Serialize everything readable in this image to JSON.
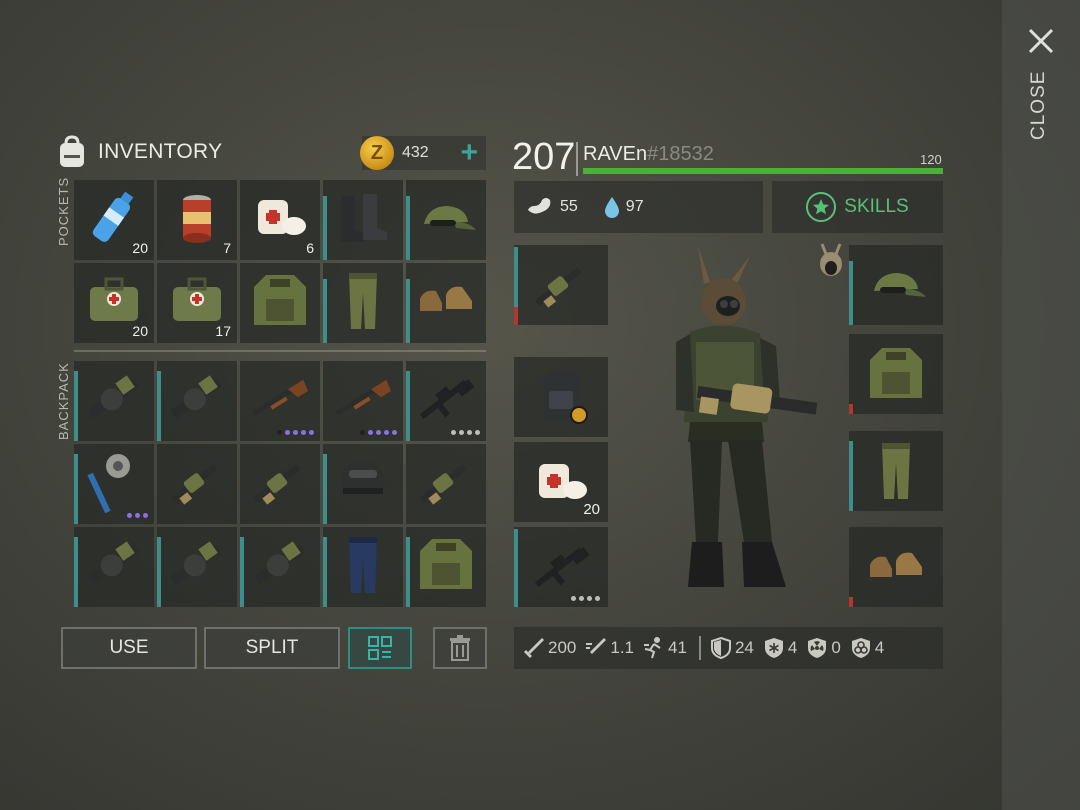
{
  "header": {
    "title": "INVENTORY",
    "coins": "432",
    "add_label": "+"
  },
  "close_label": "CLOSE",
  "sections": {
    "pockets": "POCKETS",
    "backpack": "BACKPACK"
  },
  "pockets": [
    {
      "name": "water-bottle",
      "qty": "20"
    },
    {
      "name": "canned-food",
      "qty": "7"
    },
    {
      "name": "bandage",
      "qty": "6"
    },
    {
      "name": "boots",
      "qty": ""
    },
    {
      "name": "camo-cap",
      "qty": ""
    },
    {
      "name": "medkit-bag",
      "qty": "20"
    },
    {
      "name": "medkit-bag",
      "qty": "17"
    },
    {
      "name": "camo-vest",
      "qty": ""
    },
    {
      "name": "camo-pants",
      "qty": ""
    },
    {
      "name": "brown-shoes",
      "qty": ""
    }
  ],
  "backpack": [
    {
      "name": "grenade-launcher-drum"
    },
    {
      "name": "grenade-launcher-drum"
    },
    {
      "name": "shotgun"
    },
    {
      "name": "shotgun"
    },
    {
      "name": "assault-rifle"
    },
    {
      "name": "spiked-mace"
    },
    {
      "name": "grenade-launcher"
    },
    {
      "name": "grenade-launcher"
    },
    {
      "name": "combat-helmet"
    },
    {
      "name": "grenade-launcher"
    },
    {
      "name": "grenade-launcher-drum"
    },
    {
      "name": "grenade-launcher-drum"
    },
    {
      "name": "grenade-launcher-drum"
    },
    {
      "name": "blue-pants"
    },
    {
      "name": "camo-vest"
    }
  ],
  "buttons": {
    "use": "USE",
    "split": "SPLIT"
  },
  "character": {
    "level": "207",
    "name": "RAVEn",
    "tag": "#18532",
    "xp_max": "120",
    "xp_fraction": 1.0,
    "food": "55",
    "water": "97",
    "skills_label": "SKILLS"
  },
  "equipment": {
    "weapon_primary": "grenade-launcher",
    "backpack": "backpack",
    "consumable": {
      "name": "bandage",
      "qty": "20"
    },
    "weapon_secondary": "assault-rifle",
    "head": "camo-cap",
    "body": "camo-vest",
    "legs": "camo-pants",
    "feet": "brown-shoes"
  },
  "stats": {
    "damage": "200",
    "attack_speed": "1.1",
    "movement": "41",
    "armor": "24",
    "cold": "4",
    "radiation": "0",
    "toxic": "4"
  },
  "colors": {
    "accent": "#3e8f8b",
    "xp": "#4caf3a",
    "skills": "#59c07a",
    "coin": "#e7b632"
  }
}
